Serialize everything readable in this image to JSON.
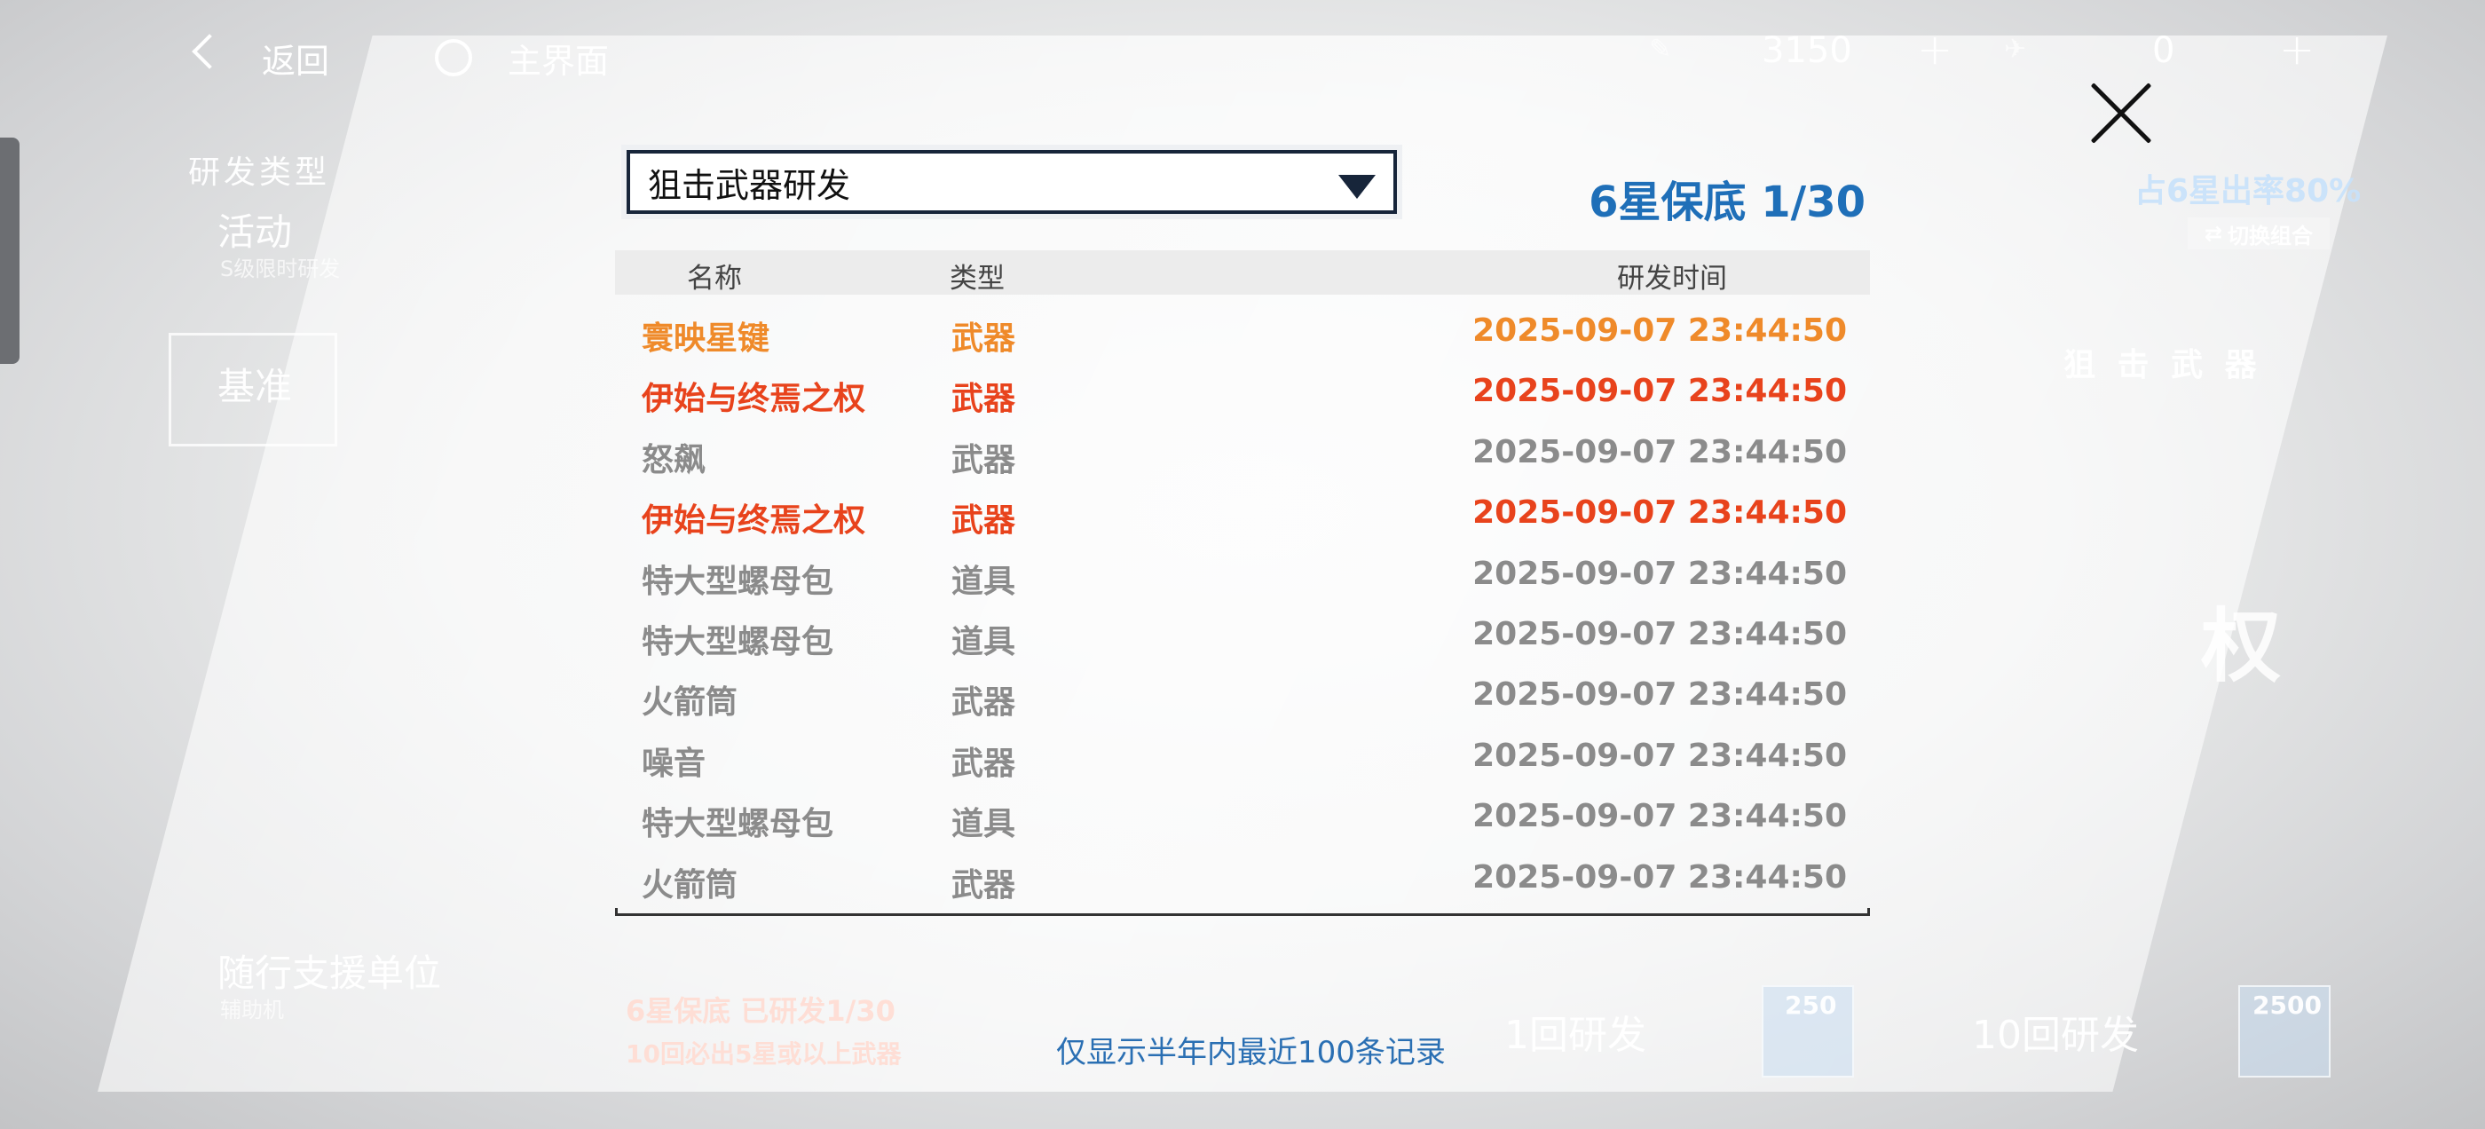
{
  "topbar": {
    "back_label": "返回",
    "home_label": "主界面",
    "currency1_value": "3150",
    "currency2_value": "0"
  },
  "background": {
    "category_title": "研发类型",
    "activity_label": "活动",
    "activity_sub": "S级限时研发",
    "base_label": "基准",
    "rate_text": "占6星出率80%",
    "switch_label": "切换组合",
    "weapon_type_label": "狙 击 武 器",
    "companion_label": "随行支援单位",
    "companion_sub": "辅助机",
    "guarantee_line1": "6星保底 已研发1/30",
    "guarantee_line2": "10回必出5星或以上武器",
    "btn_1x": "1回研发",
    "btn_1x_cost": "250",
    "btn_10x": "10回研发",
    "btn_10x_cost": "2500",
    "big_char": "权"
  },
  "modal": {
    "select_value": "狙击武器研发",
    "pity_text": "6星保底 1/30",
    "columns": [
      "名称",
      "类型",
      "研发时间"
    ],
    "footnote": "仅显示半年内最近100条记录",
    "rows": [
      {
        "name": "寰映星键",
        "type": "武器",
        "time": "2025-09-07 23:44:50",
        "color": "#ef8a2a"
      },
      {
        "name": "伊始与终焉之权",
        "type": "武器",
        "time": "2025-09-07 23:44:50",
        "color": "#e8431c"
      },
      {
        "name": "怒飙",
        "type": "武器",
        "time": "2025-09-07 23:44:50",
        "color": "#8b8b8b"
      },
      {
        "name": "伊始与终焉之权",
        "type": "武器",
        "time": "2025-09-07 23:44:50",
        "color": "#e8431c"
      },
      {
        "name": "特大型螺母包",
        "type": "道具",
        "time": "2025-09-07 23:44:50",
        "color": "#8b8b8b"
      },
      {
        "name": "特大型螺母包",
        "type": "道具",
        "time": "2025-09-07 23:44:50",
        "color": "#8b8b8b"
      },
      {
        "name": "火箭筒",
        "type": "武器",
        "time": "2025-09-07 23:44:50",
        "color": "#8b8b8b"
      },
      {
        "name": "噪音",
        "type": "武器",
        "time": "2025-09-07 23:44:50",
        "color": "#8b8b8b"
      },
      {
        "name": "特大型螺母包",
        "type": "道具",
        "time": "2025-09-07 23:44:50",
        "color": "#8b8b8b"
      },
      {
        "name": "火箭筒",
        "type": "武器",
        "time": "2025-09-07 23:44:50",
        "color": "#8b8b8b"
      }
    ]
  }
}
